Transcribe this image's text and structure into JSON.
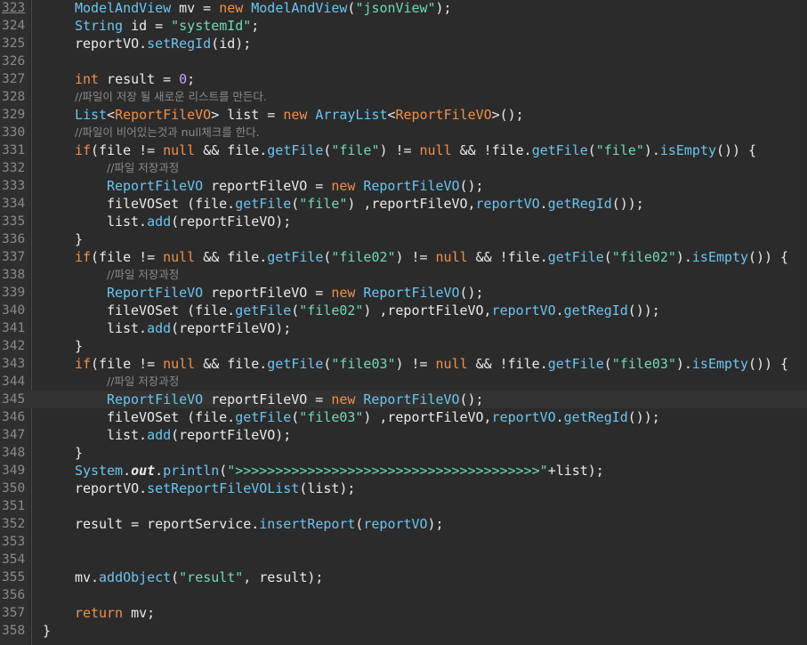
{
  "editor": {
    "highlighted_line": "345",
    "lines": [
      {
        "num": "323",
        "indent": 4,
        "tokens": [
          [
            "typ",
            "ModelAndView"
          ],
          [
            "var",
            " mv = "
          ],
          [
            "kw",
            "new"
          ],
          [
            "var",
            " "
          ],
          [
            "typ",
            "ModelAndView"
          ],
          [
            "var",
            "("
          ],
          [
            "str",
            "\"jsonView\""
          ],
          [
            "var",
            ");"
          ]
        ]
      },
      {
        "num": "324",
        "indent": 4,
        "tokens": [
          [
            "typ",
            "String"
          ],
          [
            "var",
            " id = "
          ],
          [
            "str",
            "\"systemId\""
          ],
          [
            "var",
            ";"
          ]
        ]
      },
      {
        "num": "325",
        "indent": 4,
        "tokens": [
          [
            "var",
            "reportVO."
          ],
          [
            "typ",
            "setRegId"
          ],
          [
            "var",
            "(id);"
          ]
        ]
      },
      {
        "num": "326",
        "indent": 0,
        "tokens": []
      },
      {
        "num": "327",
        "indent": 4,
        "tokens": [
          [
            "kw",
            "int"
          ],
          [
            "var",
            " result = "
          ],
          [
            "num",
            "0"
          ],
          [
            "var",
            ";"
          ]
        ]
      },
      {
        "num": "328",
        "indent": 4,
        "comment": true,
        "tokens": [
          [
            "cmt-c",
            "//파일이 저장 될 새로운 리스트를 만든다."
          ]
        ]
      },
      {
        "num": "329",
        "indent": 4,
        "tokens": [
          [
            "typ",
            "List"
          ],
          [
            "var",
            "<"
          ],
          [
            "kw",
            "ReportFileVO"
          ],
          [
            "var",
            "> list = "
          ],
          [
            "kw",
            "new"
          ],
          [
            "var",
            " "
          ],
          [
            "typ",
            "ArrayList"
          ],
          [
            "var",
            "<"
          ],
          [
            "kw",
            "ReportFileVO"
          ],
          [
            "var",
            ">();"
          ]
        ]
      },
      {
        "num": "330",
        "indent": 4,
        "comment": true,
        "tokens": [
          [
            "cmt-c",
            "//파일이 비어있는것과 null체크를 한다."
          ]
        ]
      },
      {
        "num": "331",
        "indent": 4,
        "tokens": [
          [
            "kw",
            "if"
          ],
          [
            "var",
            "(file != "
          ],
          [
            "kw",
            "null"
          ],
          [
            "var",
            " && file."
          ],
          [
            "typ",
            "getFile"
          ],
          [
            "var",
            "("
          ],
          [
            "str",
            "\"file\""
          ],
          [
            "var",
            ") != "
          ],
          [
            "kw",
            "null"
          ],
          [
            "var",
            " && !file."
          ],
          [
            "typ",
            "getFile"
          ],
          [
            "var",
            "("
          ],
          [
            "str",
            "\"file\""
          ],
          [
            "var",
            ")."
          ],
          [
            "typ",
            "isEmpty"
          ],
          [
            "var",
            "()) {"
          ]
        ]
      },
      {
        "num": "332",
        "indent": 8,
        "comment": true,
        "tokens": [
          [
            "cmt-c",
            "//파일 저장과정"
          ]
        ]
      },
      {
        "num": "333",
        "indent": 8,
        "tokens": [
          [
            "typ",
            "ReportFileVO"
          ],
          [
            "var",
            " reportFileVO = "
          ],
          [
            "kw",
            "new"
          ],
          [
            "var",
            " "
          ],
          [
            "typ",
            "ReportFileVO"
          ],
          [
            "var",
            "();"
          ]
        ]
      },
      {
        "num": "334",
        "indent": 8,
        "tokens": [
          [
            "var",
            "fileVOSet (file."
          ],
          [
            "typ",
            "getFile"
          ],
          [
            "var",
            "("
          ],
          [
            "str",
            "\"file\""
          ],
          [
            "var",
            ") ,reportFileVO,"
          ],
          [
            "typ",
            "reportVO"
          ],
          [
            "var",
            "."
          ],
          [
            "typ",
            "getRegId"
          ],
          [
            "var",
            "());"
          ]
        ]
      },
      {
        "num": "335",
        "indent": 8,
        "tokens": [
          [
            "var",
            "list."
          ],
          [
            "typ",
            "add"
          ],
          [
            "var",
            "(reportFileVO);"
          ]
        ]
      },
      {
        "num": "336",
        "indent": 4,
        "tokens": [
          [
            "var",
            "}"
          ]
        ]
      },
      {
        "num": "337",
        "indent": 4,
        "tokens": [
          [
            "kw",
            "if"
          ],
          [
            "var",
            "(file != "
          ],
          [
            "kw",
            "null"
          ],
          [
            "var",
            " && file."
          ],
          [
            "typ",
            "getFile"
          ],
          [
            "var",
            "("
          ],
          [
            "str",
            "\"file02\""
          ],
          [
            "var",
            ") != "
          ],
          [
            "kw",
            "null"
          ],
          [
            "var",
            " && !file."
          ],
          [
            "typ",
            "getFile"
          ],
          [
            "var",
            "("
          ],
          [
            "str",
            "\"file02\""
          ],
          [
            "var",
            ")."
          ],
          [
            "typ",
            "isEmpty"
          ],
          [
            "var",
            "()) {"
          ]
        ]
      },
      {
        "num": "338",
        "indent": 8,
        "comment": true,
        "tokens": [
          [
            "cmt-c",
            "//파일 저장과정"
          ]
        ]
      },
      {
        "num": "339",
        "indent": 8,
        "tokens": [
          [
            "typ",
            "ReportFileVO"
          ],
          [
            "var",
            " reportFileVO = "
          ],
          [
            "kw",
            "new"
          ],
          [
            "var",
            " "
          ],
          [
            "typ",
            "ReportFileVO"
          ],
          [
            "var",
            "();"
          ]
        ]
      },
      {
        "num": "340",
        "indent": 8,
        "tokens": [
          [
            "var",
            "fileVOSet (file."
          ],
          [
            "typ",
            "getFile"
          ],
          [
            "var",
            "("
          ],
          [
            "str",
            "\"file02\""
          ],
          [
            "var",
            ") ,reportFileVO,"
          ],
          [
            "typ",
            "reportVO"
          ],
          [
            "var",
            "."
          ],
          [
            "typ",
            "getRegId"
          ],
          [
            "var",
            "());"
          ]
        ]
      },
      {
        "num": "341",
        "indent": 8,
        "tokens": [
          [
            "var",
            "list."
          ],
          [
            "typ",
            "add"
          ],
          [
            "var",
            "(reportFileVO);"
          ]
        ]
      },
      {
        "num": "342",
        "indent": 4,
        "tokens": [
          [
            "var",
            "}"
          ]
        ]
      },
      {
        "num": "343",
        "indent": 4,
        "tokens": [
          [
            "kw",
            "if"
          ],
          [
            "var",
            "(file != "
          ],
          [
            "kw",
            "null"
          ],
          [
            "var",
            " && file."
          ],
          [
            "typ",
            "getFile"
          ],
          [
            "var",
            "("
          ],
          [
            "str",
            "\"file03\""
          ],
          [
            "var",
            ") != "
          ],
          [
            "kw",
            "null"
          ],
          [
            "var",
            " && !file."
          ],
          [
            "typ",
            "getFile"
          ],
          [
            "var",
            "("
          ],
          [
            "str",
            "\"file03\""
          ],
          [
            "var",
            ")."
          ],
          [
            "typ",
            "isEmpty"
          ],
          [
            "var",
            "()) {"
          ]
        ]
      },
      {
        "num": "344",
        "indent": 8,
        "comment": true,
        "tokens": [
          [
            "cmt-c",
            "//파일 저장과정"
          ]
        ]
      },
      {
        "num": "345",
        "indent": 8,
        "tokens": [
          [
            "typ",
            "ReportFileVO"
          ],
          [
            "var",
            " reportFileVO = "
          ],
          [
            "kw",
            "new"
          ],
          [
            "var",
            " "
          ],
          [
            "typ",
            "ReportFileVO"
          ],
          [
            "var",
            "();"
          ]
        ]
      },
      {
        "num": "346",
        "indent": 8,
        "tokens": [
          [
            "var",
            "fileVOSet (file."
          ],
          [
            "typ",
            "getFile"
          ],
          [
            "var",
            "("
          ],
          [
            "str",
            "\"file03\""
          ],
          [
            "var",
            ") ,reportFileVO,"
          ],
          [
            "typ",
            "reportVO"
          ],
          [
            "var",
            "."
          ],
          [
            "typ",
            "getRegId"
          ],
          [
            "var",
            "());"
          ]
        ]
      },
      {
        "num": "347",
        "indent": 8,
        "tokens": [
          [
            "var",
            "list."
          ],
          [
            "typ",
            "add"
          ],
          [
            "var",
            "(reportFileVO);"
          ]
        ]
      },
      {
        "num": "348",
        "indent": 4,
        "tokens": [
          [
            "var",
            "}"
          ]
        ]
      },
      {
        "num": "349",
        "indent": 4,
        "tokens": [
          [
            "typ",
            "System"
          ],
          [
            "var",
            "."
          ],
          [
            "fld",
            "out"
          ],
          [
            "var",
            "."
          ],
          [
            "typ",
            "println"
          ],
          [
            "var",
            "("
          ],
          [
            "str",
            "\">>>>>>>>>>>>>>>>>>>>>>>>>>>>>>>>>>>>>>\""
          ],
          [
            "var",
            "+list);"
          ]
        ]
      },
      {
        "num": "350",
        "indent": 4,
        "tokens": [
          [
            "var",
            "reportVO."
          ],
          [
            "typ",
            "setReportFileVOList"
          ],
          [
            "var",
            "(list);"
          ]
        ]
      },
      {
        "num": "351",
        "indent": 0,
        "tokens": []
      },
      {
        "num": "352",
        "indent": 4,
        "tokens": [
          [
            "var",
            "result = reportService."
          ],
          [
            "typ",
            "insertReport"
          ],
          [
            "var",
            "("
          ],
          [
            "typ",
            "reportVO"
          ],
          [
            "var",
            ");"
          ]
        ]
      },
      {
        "num": "353",
        "indent": 0,
        "tokens": []
      },
      {
        "num": "354",
        "indent": 0,
        "tokens": []
      },
      {
        "num": "355",
        "indent": 4,
        "tokens": [
          [
            "var",
            "mv."
          ],
          [
            "typ",
            "addObject"
          ],
          [
            "var",
            "("
          ],
          [
            "str",
            "\"result\""
          ],
          [
            "var",
            ", result);"
          ]
        ]
      },
      {
        "num": "356",
        "indent": 0,
        "tokens": []
      },
      {
        "num": "357",
        "indent": 4,
        "tokens": [
          [
            "kw",
            "return"
          ],
          [
            "var",
            " mv;"
          ]
        ]
      },
      {
        "num": "358",
        "indent": 0,
        "tokens": [
          [
            "var",
            "}"
          ]
        ]
      }
    ]
  }
}
